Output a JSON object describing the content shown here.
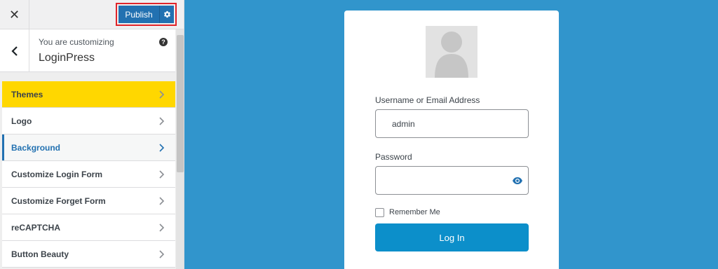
{
  "topbar": {
    "close_label": "✕",
    "publish_label": "Publish"
  },
  "info": {
    "subtitle": "You are customizing",
    "title": "LoginPress",
    "help_label": "?"
  },
  "menu": [
    {
      "label": "Themes"
    },
    {
      "label": "Logo"
    },
    {
      "label": "Background"
    },
    {
      "label": "Customize Login Form"
    },
    {
      "label": "Customize Forget Form"
    },
    {
      "label": "reCAPTCHA"
    },
    {
      "label": "Button Beauty"
    }
  ],
  "login": {
    "username_label": "Username or Email Address",
    "username_value": "admin",
    "password_label": "Password",
    "remember_label": "Remember Me",
    "login_button": "Log In"
  },
  "colors": {
    "preview_background": "#3195cc",
    "primary": "#2271b1",
    "themes_highlight": "#ffd700",
    "login_button": "#0c8fca",
    "publish_highlight_border": "#e0242a"
  }
}
